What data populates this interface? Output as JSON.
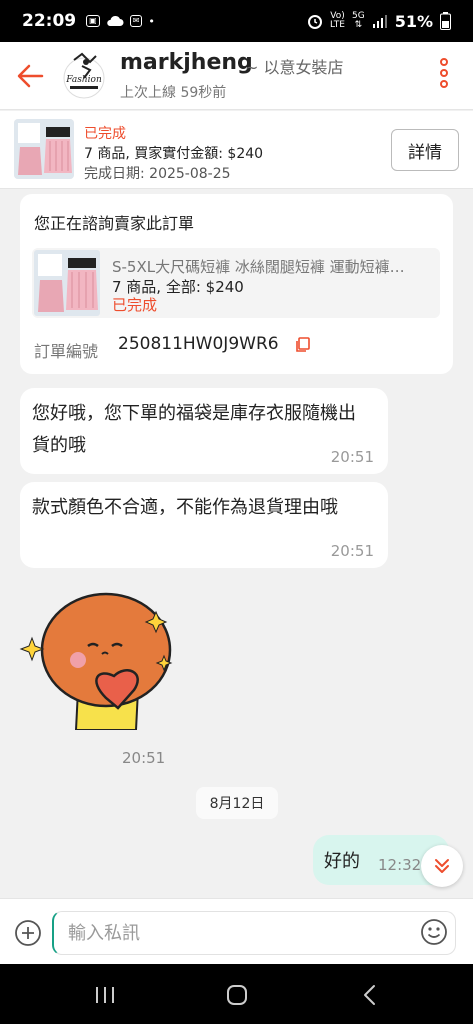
{
  "status_bar": {
    "time": "22:09",
    "battery": "51%",
    "net1": "Vo)",
    "net1b": "LTE",
    "net2": "5G"
  },
  "header": {
    "name": "markjheng",
    "shop": "~ 以意女裝店",
    "last_seen": "上次上線 59秒前"
  },
  "order_banner": {
    "status": "已完成",
    "summary": "7 商品, 買家實付金額: $240",
    "date": "完成日期: 2025-08-25",
    "detail_label": "詳情"
  },
  "inquiry_card": {
    "title": "您正在諮詢賣家此訂單",
    "product_name": "S-5XL大尺碼短褲 冰絲闊腿短褲 運動短褲…",
    "product_qty": "7 商品, 全部: $240",
    "product_status": "已完成",
    "order_label": "訂單編號",
    "order_number": "250811HW0J9WR6"
  },
  "messages": [
    {
      "text": "您好哦，您下單的福袋是庫存衣服隨機出貨的哦",
      "time": "20:51"
    },
    {
      "text": "款式顏色不合適，不能作為退貨理由哦",
      "time": "20:51"
    }
  ],
  "sticker_time": "20:51",
  "date_separator": "8月12日",
  "my_message": {
    "text": "好的",
    "time": "12:32"
  },
  "input": {
    "placeholder": "輸入私訊"
  },
  "colors": {
    "accent": "#ee4d2d",
    "my_bubble": "#d8f5ee"
  }
}
